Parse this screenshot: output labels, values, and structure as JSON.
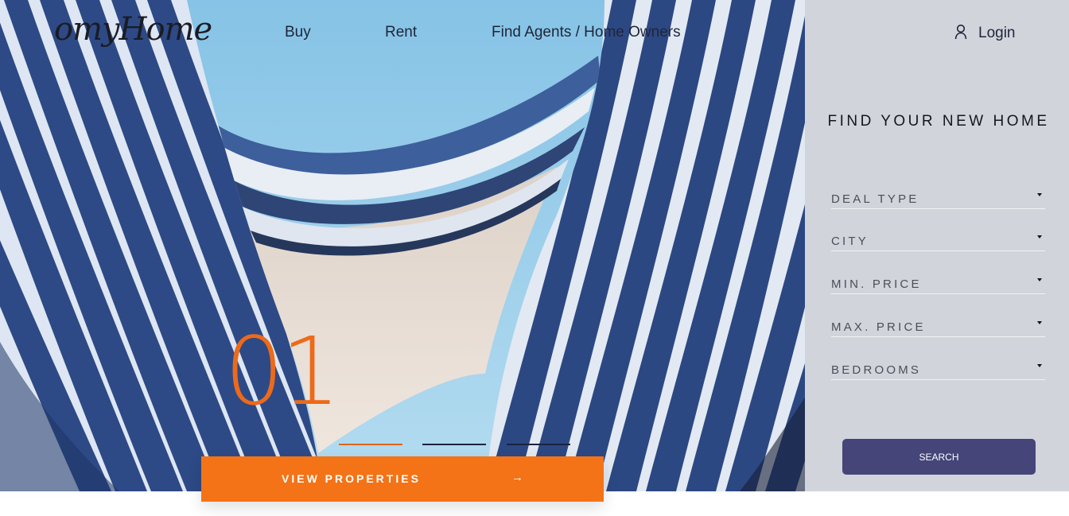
{
  "brand": {
    "logo_text": "omyHome"
  },
  "nav": {
    "links": [
      {
        "label": "Buy"
      },
      {
        "label": "Rent"
      },
      {
        "label": "Find Agents / Home Owners"
      }
    ],
    "login_label": "Login"
  },
  "hero": {
    "slide_number": "01",
    "cta_label": "VIEW PROPERTIES",
    "cta_arrow": "→",
    "slides": {
      "active_index": 0,
      "count": 3
    }
  },
  "search_panel": {
    "title": "FIND YOUR NEW HOME",
    "fields": [
      {
        "label": "DEAL TYPE"
      },
      {
        "label": "CITY"
      },
      {
        "label": "MIN. PRICE"
      },
      {
        "label": "MAX. PRICE"
      },
      {
        "label": "BEDROOMS"
      }
    ],
    "search_label": "SEARCH"
  },
  "colors": {
    "accent": "#f47316",
    "slide_number": "#ec6a1a",
    "panel_bg": "#d2d4dc",
    "search_button": "#45457a",
    "text_dark": "#1f2538"
  },
  "icons": {
    "login": "user-icon",
    "cta": "arrow-right-icon",
    "dropdown": "caret-down-icon"
  }
}
